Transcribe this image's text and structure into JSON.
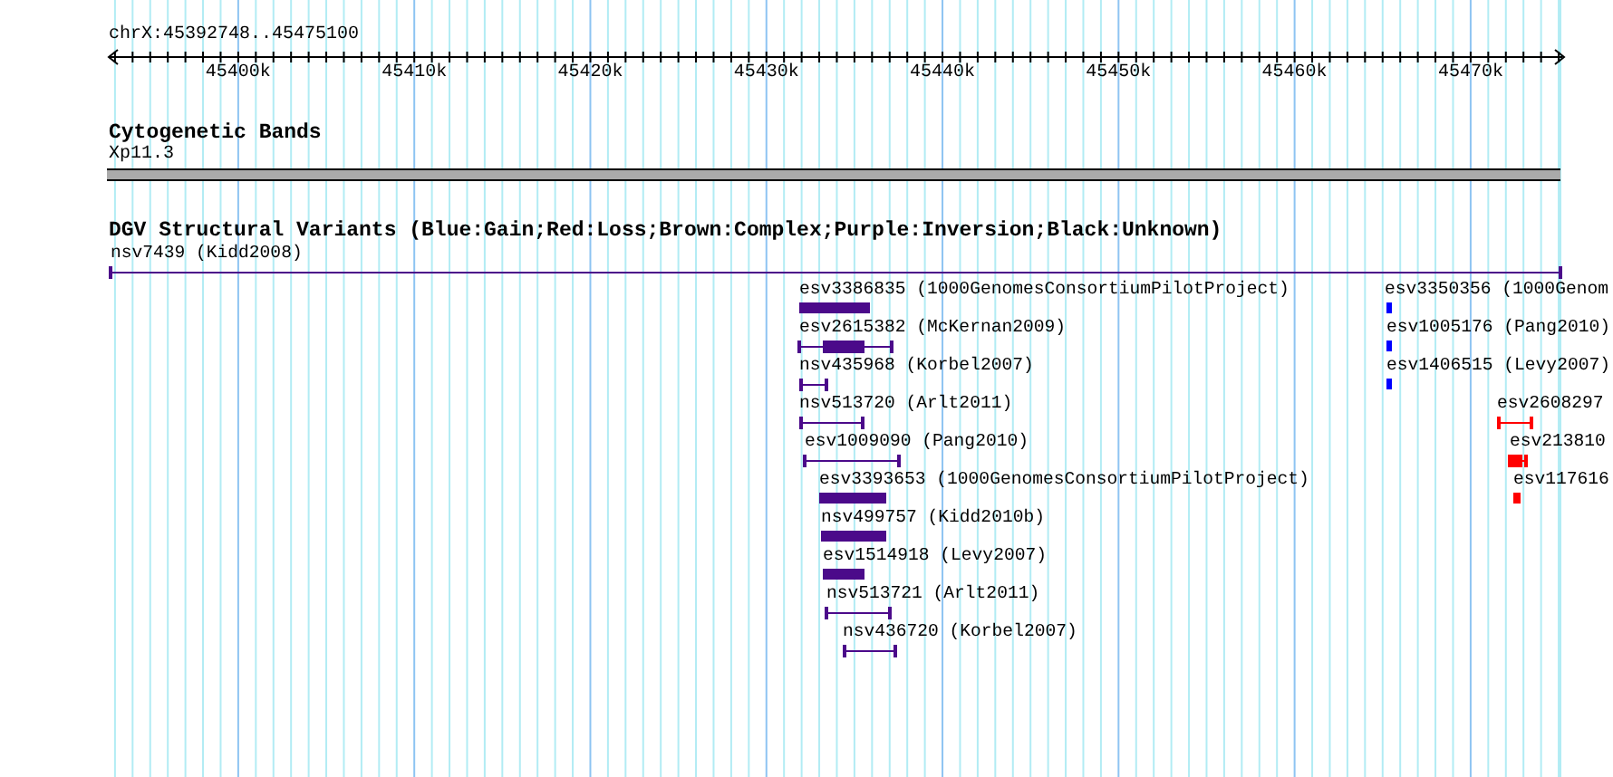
{
  "ruler": {
    "location": "chrX:45392748..45475100",
    "ticks": [
      "45400k",
      "45410k",
      "45420k",
      "45430k",
      "45440k",
      "45450k",
      "45460k",
      "45470k"
    ]
  },
  "cytoband_track": {
    "title": "Cytogenetic Bands",
    "band": "Xp11.3"
  },
  "dgv_track": {
    "title": "DGV Structural Variants (Blue:Gain;Red:Loss;Brown:Complex;Purple:Inversion;Black:Unknown)",
    "features": [
      {
        "label": "nsv7439 (Kidd2008)",
        "kind": "span",
        "color": "#4b0a8a"
      },
      {
        "label": "esv3386835 (1000GenomesConsortiumPilotProject)",
        "kind": "bar",
        "color": "#4b0a8a"
      },
      {
        "label": "esv3350356 (1000Genom",
        "kind": "bar",
        "color": "#0000ff"
      },
      {
        "label": "esv2615382 (McKernan2009)",
        "kind": "span_block",
        "color": "#4b0a8a"
      },
      {
        "label": "esv1005176 (Pang2010)",
        "kind": "bar",
        "color": "#0000ff"
      },
      {
        "label": "nsv435968 (Korbel2007)",
        "kind": "span",
        "color": "#4b0a8a"
      },
      {
        "label": "esv1406515 (Levy2007)",
        "kind": "bar",
        "color": "#0000ff"
      },
      {
        "label": "nsv513720 (Arlt2011)",
        "kind": "span",
        "color": "#4b0a8a"
      },
      {
        "label": "esv2608297",
        "kind": "span",
        "color": "#ff0000"
      },
      {
        "label": "esv1009090 (Pang2010)",
        "kind": "span",
        "color": "#4b0a8a"
      },
      {
        "label": "esv213810",
        "kind": "span_block",
        "color": "#ff0000"
      },
      {
        "label": "esv3393653 (1000GenomesConsortiumPilotProject)",
        "kind": "bar",
        "color": "#4b0a8a"
      },
      {
        "label": "esv117616",
        "kind": "bar",
        "color": "#ff0000"
      },
      {
        "label": "nsv499757 (Kidd2010b)",
        "kind": "bar",
        "color": "#4b0a8a"
      },
      {
        "label": "esv1514918 (Levy2007)",
        "kind": "bar",
        "color": "#4b0a8a"
      },
      {
        "label": "nsv513721 (Arlt2011)",
        "kind": "span",
        "color": "#4b0a8a"
      },
      {
        "label": "nsv436720 (Korbel2007)",
        "kind": "span",
        "color": "#4b0a8a"
      }
    ]
  }
}
